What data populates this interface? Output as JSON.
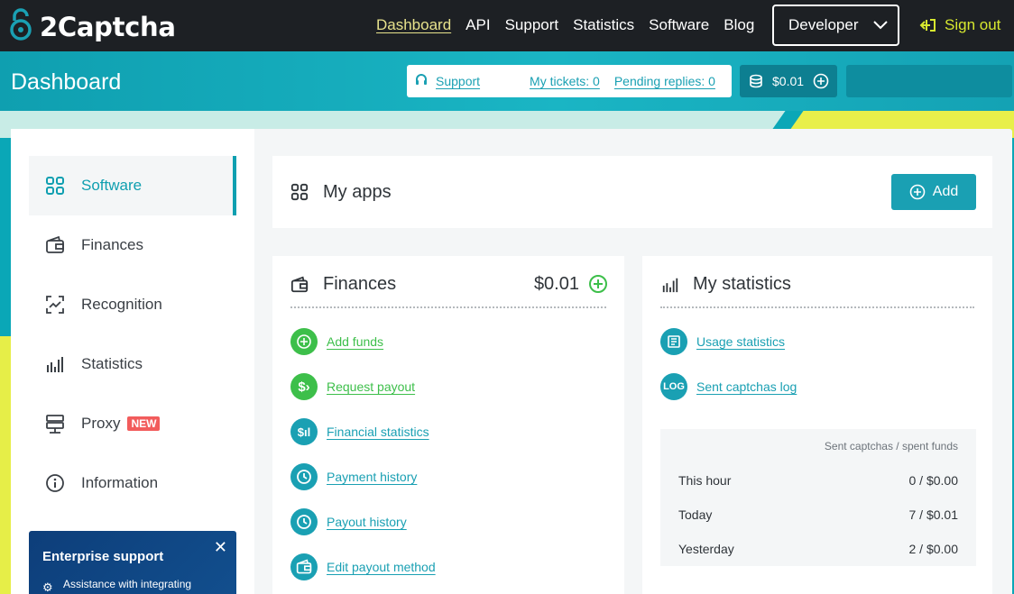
{
  "brand": {
    "name": "2Captcha",
    "accent": "#1aa0b3",
    "dark": "#1d2024"
  },
  "nav": [
    {
      "label": "Dashboard",
      "active": true
    },
    {
      "label": "API"
    },
    {
      "label": "Support"
    },
    {
      "label": "Statistics"
    },
    {
      "label": "Software"
    },
    {
      "label": "Blog"
    }
  ],
  "role_select": {
    "value": "Developer"
  },
  "signout_label": "Sign out",
  "header": {
    "title": "Dashboard",
    "support_label": "Support",
    "tickets_label": "My tickets: 0",
    "pending_label": "Pending replies: 0",
    "balance": "$0.01"
  },
  "sidebar": {
    "items": [
      {
        "label": "Software",
        "icon": "grid-icon",
        "active": true
      },
      {
        "label": "Finances",
        "icon": "wallet-icon"
      },
      {
        "label": "Recognition",
        "icon": "scan-icon"
      },
      {
        "label": "Statistics",
        "icon": "bar-chart-icon"
      },
      {
        "label": "Proxy",
        "icon": "server-icon",
        "badge": "NEW"
      },
      {
        "label": "Information",
        "icon": "info-icon"
      }
    ],
    "enterprise": {
      "title": "Enterprise support",
      "subtitle": "Assistance with integrating"
    }
  },
  "apps": {
    "title": "My apps",
    "add_label": "Add"
  },
  "finances": {
    "title": "Finances",
    "balance": "$0.01",
    "links": [
      {
        "label": "Add funds",
        "icon": "plus-icon",
        "color": "green"
      },
      {
        "label": "Request payout",
        "icon": "dollar-arrow-icon",
        "color": "green"
      },
      {
        "label": "Financial statistics",
        "icon": "dollar-chart-icon",
        "color": "teal"
      },
      {
        "label": "Payment history",
        "icon": "history-icon",
        "color": "teal"
      },
      {
        "label": "Payout history",
        "icon": "history-icon",
        "color": "teal"
      },
      {
        "label": "Edit payout method",
        "icon": "wallet-icon",
        "color": "teal"
      }
    ]
  },
  "my_statistics": {
    "title": "My statistics",
    "links": [
      {
        "label": "Usage statistics",
        "icon": "usage-icon"
      },
      {
        "label": "Sent captchas log",
        "icon": "log-icon"
      }
    ],
    "table_header": "Sent captchas / spent funds",
    "rows": [
      {
        "period": "This hour",
        "value": "0 / $0.00"
      },
      {
        "period": "Today",
        "value": "7 / $0.01"
      },
      {
        "period": "Yesterday",
        "value": "2 / $0.00"
      }
    ]
  }
}
